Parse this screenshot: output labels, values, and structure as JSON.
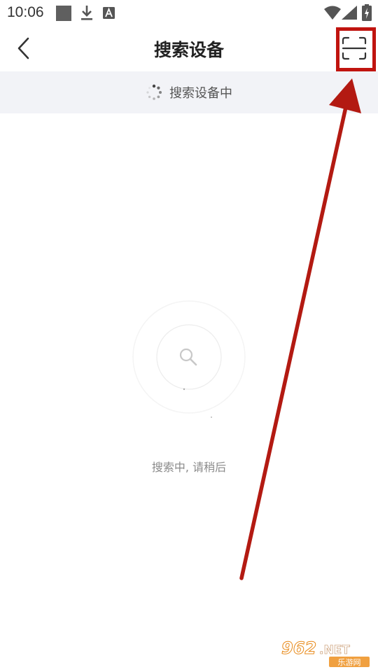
{
  "status_bar": {
    "time": "10:06",
    "icons": [
      "notification-square-icon",
      "download-icon",
      "font-a-icon",
      "wifi-icon",
      "signal-icon",
      "battery-charging-icon"
    ]
  },
  "nav": {
    "title": "搜索设备",
    "back_icon": "chevron-left-icon",
    "scan_icon": "scan-icon"
  },
  "banner": {
    "text": "搜索设备中",
    "icon": "loading-spinner-icon"
  },
  "main": {
    "hint": "搜索中, 请稍后",
    "center_icon": "magnifier-icon"
  },
  "annotation": {
    "highlight_color": "#c0140f",
    "arrow_color": "#b31a12"
  },
  "watermark": {
    "logo_text": "962.NET",
    "sub_text": "乐游网"
  }
}
